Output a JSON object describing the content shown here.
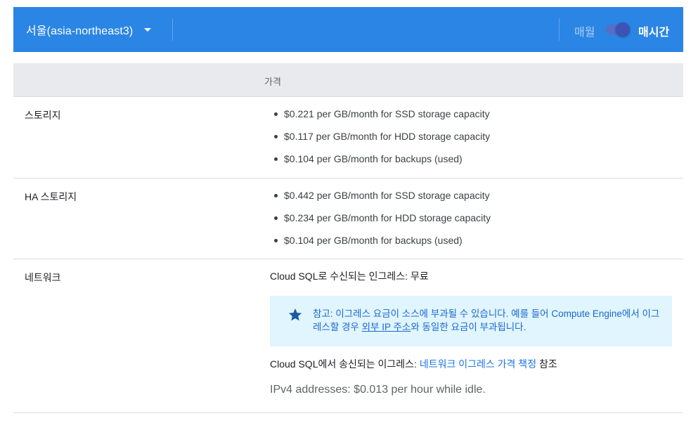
{
  "toolbar": {
    "region": "서울(asia-northeast3)",
    "period_monthly": "매월",
    "period_hourly": "매시간",
    "toggle_state": "hourly"
  },
  "table": {
    "header_price": "가격",
    "rows": [
      {
        "label": "스토리지",
        "items": [
          "$0.221 per GB/month for SSD storage capacity",
          "$0.117 per GB/month for HDD storage capacity",
          "$0.104 per GB/month for backups (used)"
        ]
      },
      {
        "label": "HA 스토리지",
        "items": [
          "$0.442 per GB/month for SSD storage capacity",
          "$0.234 per GB/month for HDD storage capacity",
          "$0.104 per GB/month for backups (used)"
        ]
      }
    ],
    "network": {
      "label": "네트워크",
      "ingress": "Cloud SQL로 수신되는 인그레스: 무료",
      "note_prefix": "참고: 이그레스 요금이 소스에 부과될 수 있습니다. 예를 들어 Compute Engine에서 이그레스할 경우 ",
      "note_link": "외부 IP 주소",
      "note_suffix": "와 동일한 요금이 부과됩니다.",
      "egress_prefix": "Cloud SQL에서 송신되는 이그레스: ",
      "egress_link": "네트워크 이그레스 가격 책정",
      "egress_suffix": " 참조",
      "ipv4": "IPv4 addresses: $0.013 per hour while idle."
    }
  },
  "colors": {
    "toolbar_bg": "#2b85e4",
    "header_bg": "#e8eaed",
    "note_bg": "#e1f5fe",
    "link": "#1a73e8",
    "star": "#1a5ca8"
  },
  "icons": {
    "caret": "caret-down-icon",
    "note": "star-icon"
  }
}
